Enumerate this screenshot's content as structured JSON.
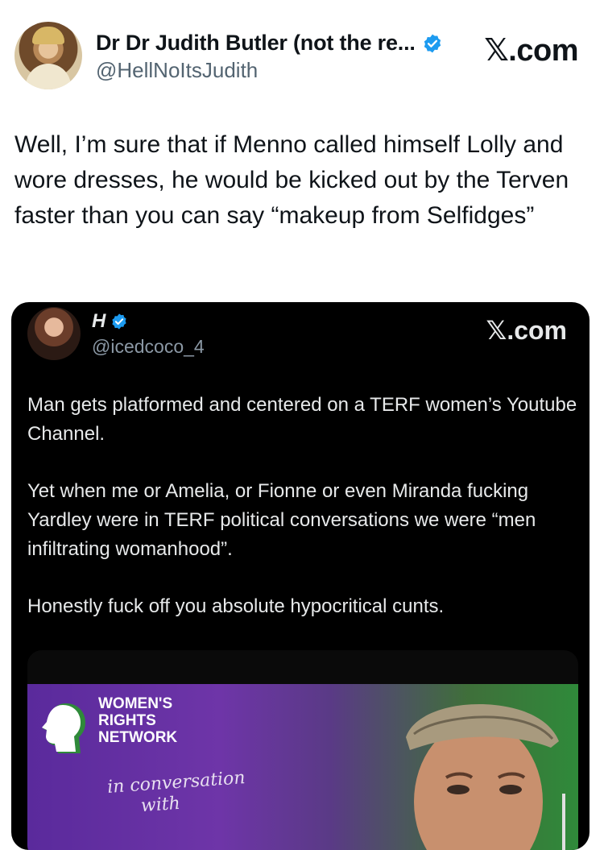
{
  "author": {
    "display_name": "Dr Dr Judith Butler (not the re...",
    "handle": "@HellNoItsJudith",
    "verified": true,
    "site_badge": "𝕏.com"
  },
  "tweet": {
    "text": "Well, I’m sure that if Menno called himself Lolly and wore dresses, he would be kicked out by the Terven faster than you can say “makeup from Selfidges”"
  },
  "quoted_tweet": {
    "display_name": "H",
    "handle": "@icedcoco_4",
    "verified": true,
    "site_badge": "𝕏.com",
    "paragraphs": [
      "Man gets platformed and centered on a TERF women’s Youtube Channel.",
      "Yet when me or Amelia, or Fionne or even Miranda fucking Yardley were in TERF political conversations we were “men infiltrating womanhood”.",
      "Honestly fuck off you absolute hypocritical cunts."
    ],
    "media": {
      "org_name": "WOMEN'S RIGHTS NETWORK",
      "org_name_lines": [
        "WOMEN'S",
        "RIGHTS",
        "NETWORK"
      ],
      "script_lines": [
        "in conversation",
        "with"
      ]
    }
  },
  "colors": {
    "verified_blue": "#1d9bf0",
    "handle_gray": "#536471",
    "quote_bg": "#000000",
    "banner_purple": "#6e35a8",
    "banner_green": "#2f8a3a"
  }
}
